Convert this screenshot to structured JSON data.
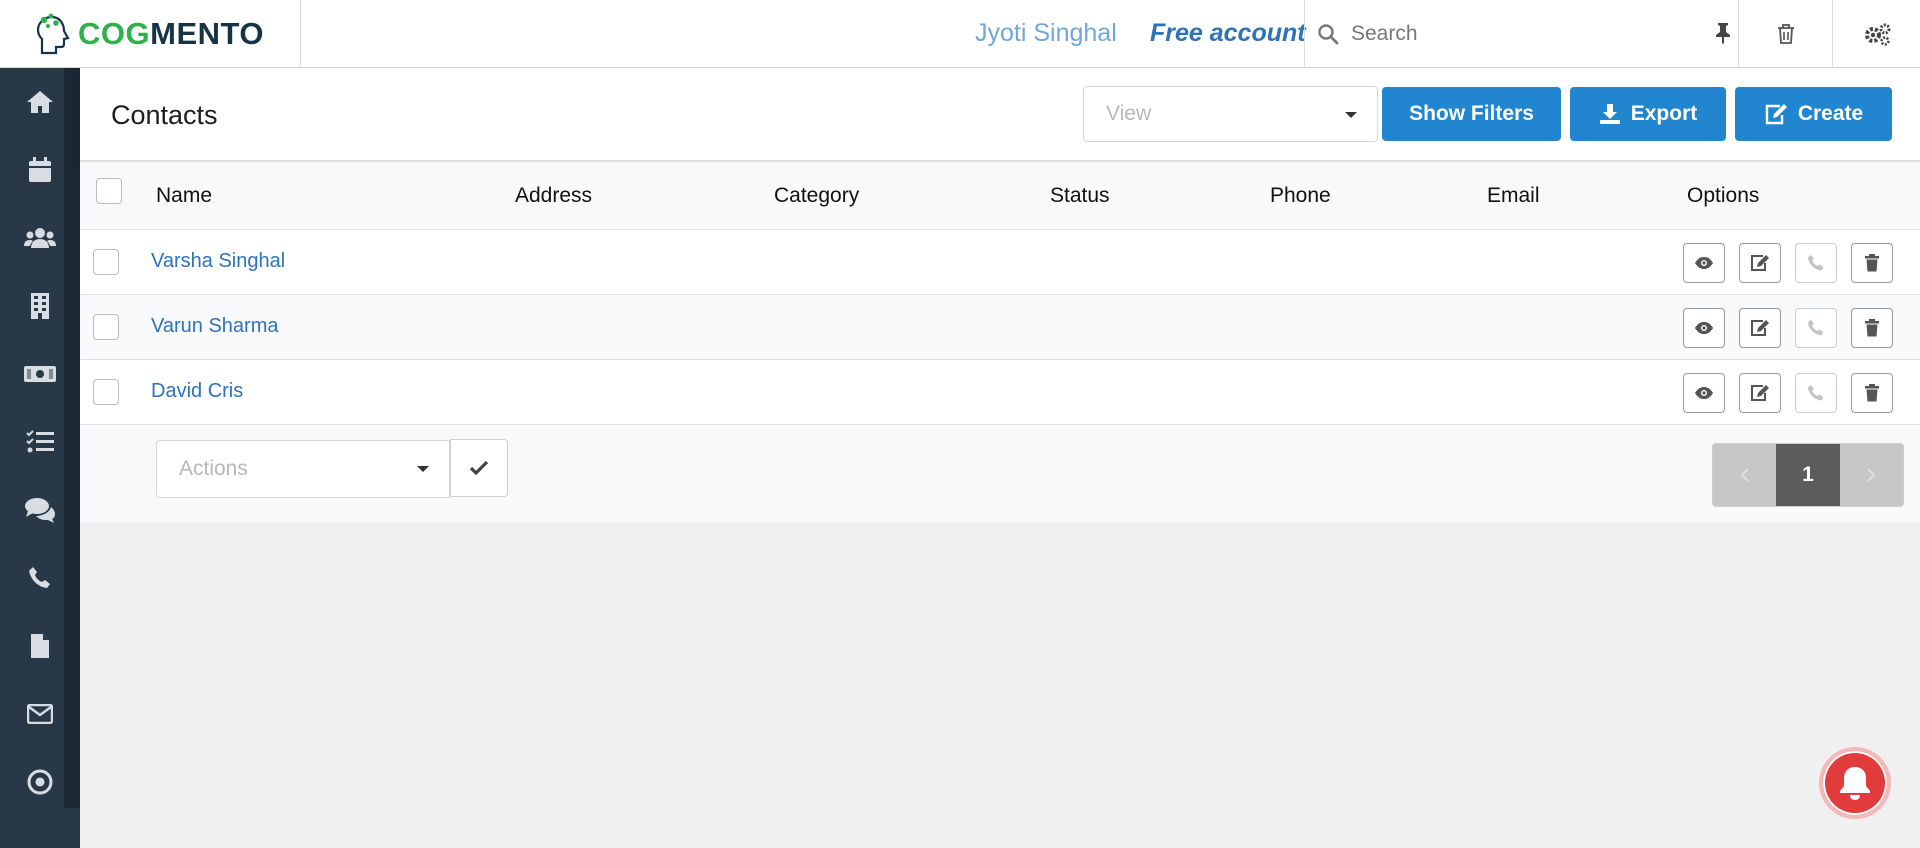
{
  "app": {
    "brand_part1": "COG",
    "brand_part2": "MENTO"
  },
  "header": {
    "user_name": "Jyoti Singhal",
    "account_type": "Free account",
    "search": {
      "placeholder": "Search",
      "value": ""
    }
  },
  "sidebar": {
    "items": [
      {
        "name": "home",
        "icon": "home-icon"
      },
      {
        "name": "calendar",
        "icon": "calendar-icon"
      },
      {
        "name": "contacts",
        "icon": "users-icon"
      },
      {
        "name": "companies",
        "icon": "building-icon"
      },
      {
        "name": "deals",
        "icon": "money-icon"
      },
      {
        "name": "tasks",
        "icon": "tasks-icon"
      },
      {
        "name": "cases",
        "icon": "comments-icon"
      },
      {
        "name": "calls",
        "icon": "phone-icon"
      },
      {
        "name": "documents",
        "icon": "file-icon"
      },
      {
        "name": "email",
        "icon": "envelope-icon"
      },
      {
        "name": "campaigns",
        "icon": "bullseye-icon"
      }
    ]
  },
  "page": {
    "title": "Contacts",
    "view_placeholder": "View",
    "show_filters_label": "Show Filters",
    "export_label": "Export",
    "create_label": "Create"
  },
  "table": {
    "columns": [
      "Name",
      "Address",
      "Category",
      "Status",
      "Phone",
      "Email",
      "Options"
    ],
    "rows": [
      {
        "name": "Varsha Singhal",
        "address": "",
        "category": "",
        "status": "",
        "phone": "",
        "email": ""
      },
      {
        "name": "Varun Sharma",
        "address": "",
        "category": "",
        "status": "",
        "phone": "",
        "email": ""
      },
      {
        "name": "David Cris",
        "address": "",
        "category": "",
        "status": "",
        "phone": "",
        "email": ""
      }
    ],
    "actions_placeholder": "Actions",
    "pagination": {
      "current_page": "1"
    }
  },
  "colors": {
    "primary": "#2185d0",
    "sidebar": "#283846",
    "link": "#2e73b8",
    "brand_green": "#2db14a",
    "brand_dark": "#173447",
    "alert": "#e13b3b"
  }
}
